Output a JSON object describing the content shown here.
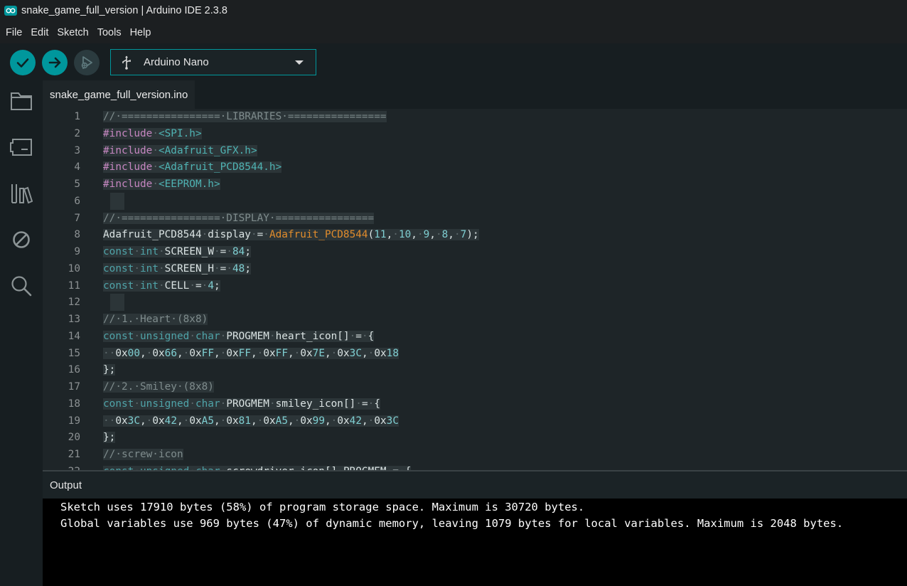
{
  "window": {
    "title": "snake_game_full_version | Arduino IDE 2.3.8"
  },
  "menu": [
    "File",
    "Edit",
    "Sketch",
    "Tools",
    "Help"
  ],
  "toolbar": {
    "board": "Arduino Nano"
  },
  "tab": {
    "file_name": "snake_game_full_version.ino"
  },
  "editor": {
    "lines": [
      {
        "no": "1",
        "text": "//·================·LIBRARIES·================"
      },
      {
        "no": "2",
        "text": "#include·<SPI.h>"
      },
      {
        "no": "3",
        "text": "#include·<Adafruit_GFX.h>"
      },
      {
        "no": "4",
        "text": "#include·<Adafruit_PCD8544.h>"
      },
      {
        "no": "5",
        "text": "#include·<EEPROM.h>"
      },
      {
        "no": "6",
        "text": ""
      },
      {
        "no": "7",
        "text": "//·================·DISPLAY·================"
      },
      {
        "no": "8",
        "text": "Adafruit_PCD8544·display·=·Adafruit_PCD8544(11,·10,·9,·8,·7);"
      },
      {
        "no": "9",
        "text": "const·int·SCREEN_W·=·84;"
      },
      {
        "no": "10",
        "text": "const·int·SCREEN_H·=·48;"
      },
      {
        "no": "11",
        "text": "const·int·CELL·=·4;"
      },
      {
        "no": "12",
        "text": ""
      },
      {
        "no": "13",
        "text": "//·1.·Heart·(8x8)"
      },
      {
        "no": "14",
        "text": "const·unsigned·char·PROGMEM·heart_icon[]·=·{"
      },
      {
        "no": "15",
        "text": "··0x00,·0x66,·0xFF,·0xFF,·0xFF,·0x7E,·0x3C,·0x18"
      },
      {
        "no": "16",
        "text": "};"
      },
      {
        "no": "17",
        "text": "//·2.·Smiley·(8x8)"
      },
      {
        "no": "18",
        "text": "const·unsigned·char·PROGMEM·smiley_icon[]·=·{"
      },
      {
        "no": "19",
        "text": "··0x3C,·0x42,·0xA5,·0x81,·0xA5,·0x99,·0x42,·0x3C"
      },
      {
        "no": "20",
        "text": "};"
      },
      {
        "no": "21",
        "text": "//·screw·icon"
      },
      {
        "no": "22",
        "text": "const·unsigned·char·screwdriver_icon[]·PROGMEM·=·{"
      }
    ]
  },
  "output": {
    "title": "Output",
    "lines": [
      "Sketch uses 17910 bytes (58%) of program storage space. Maximum is 30720 bytes.",
      "Global variables use 969 bytes (47%) of dynamic memory, leaving 1079 bytes for local variables. Maximum is 2048 bytes."
    ]
  },
  "icons": {
    "verify": "check-icon",
    "upload": "arrow-right-icon",
    "debug": "debugger-icon",
    "board": "usb-icon",
    "sidebar": [
      "folder-icon",
      "board-manager-icon",
      "library-icon",
      "debug-off-icon",
      "search-icon"
    ]
  },
  "colors": {
    "accent": "#00979c",
    "background": "#1e2528",
    "console": "#000000",
    "comment": "#7f8c8d",
    "preprocessor": "#c586c0",
    "keyword": "#4fa3a8",
    "function": "#e08c2c",
    "number": "#7fcfd2"
  }
}
